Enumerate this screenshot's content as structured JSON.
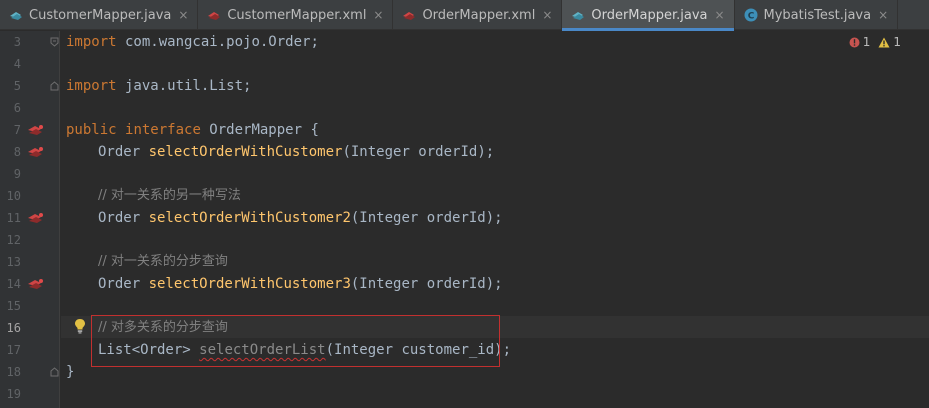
{
  "tabs": [
    {
      "label": "CustomerMapper.java",
      "icon": "mapper-java-icon",
      "active": false
    },
    {
      "label": "CustomerMapper.xml",
      "icon": "mapper-xml-icon",
      "active": false
    },
    {
      "label": "OrderMapper.xml",
      "icon": "mapper-xml-icon",
      "active": false
    },
    {
      "label": "OrderMapper.java",
      "icon": "mapper-java-icon",
      "active": true
    },
    {
      "label": "MybatisTest.java",
      "icon": "java-class-icon",
      "active": false
    }
  ],
  "close_glyph": "×",
  "inspections": {
    "errors": "1",
    "warnings": "1"
  },
  "lines": {
    "3": {
      "num": "3"
    },
    "4": {
      "num": "4"
    },
    "5": {
      "num": "5"
    },
    "6": {
      "num": "6"
    },
    "7": {
      "num": "7"
    },
    "8": {
      "num": "8"
    },
    "9": {
      "num": "9"
    },
    "10": {
      "num": "10"
    },
    "11": {
      "num": "11"
    },
    "12": {
      "num": "12"
    },
    "13": {
      "num": "13"
    },
    "14": {
      "num": "14"
    },
    "15": {
      "num": "15"
    },
    "16": {
      "num": "16"
    },
    "17": {
      "num": "17"
    },
    "18": {
      "num": "18"
    },
    "19": {
      "num": "19"
    }
  },
  "code": {
    "l3_kw": "import",
    "l3_rest": " com.wangcai.pojo.Order;",
    "l5_kw": "import",
    "l5_rest": " java.util.List;",
    "l7_kw1": "public",
    "l7_kw2": "interface",
    "l7_rest": " OrderMapper {",
    "l8_type": "Order ",
    "l8_fn": "selectOrderWithCustomer",
    "l8_rest": "(Integer orderId);",
    "l10_comment": "// 对一关系的另一种写法",
    "l11_type": "Order ",
    "l11_fn": "selectOrderWithCustomer2",
    "l11_rest": "(Integer orderId);",
    "l13_comment": "// 对一关系的分步查询",
    "l14_type": "Order ",
    "l14_fn": "selectOrderWithCustomer3",
    "l14_rest": "(Integer orderId);",
    "l16_comment": "// 对多关系的分步查询",
    "l17_type": "List<Order> ",
    "l17_fn": "selectOrderList",
    "l17_rest": "(Integer customer_id);",
    "l18_brace": "}"
  },
  "colors": {
    "accent": "#4a88c7",
    "keyword": "#cc7832",
    "method": "#ffc66d",
    "comment": "#808080",
    "error": "#c2302f",
    "warning": "#e2c044"
  }
}
